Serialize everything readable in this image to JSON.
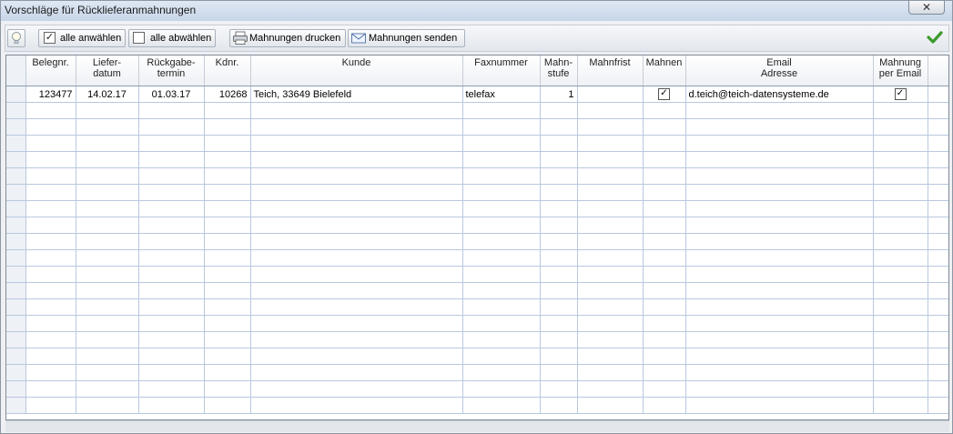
{
  "window": {
    "title": "Vorschläge für Rücklieferanmahnungen",
    "close_glyph": "✕"
  },
  "toolbar": {
    "select_all_label": "alle anwählen",
    "deselect_all_label": "alle abwählen",
    "print_label": "Mahnungen drucken",
    "send_label": "Mahnungen senden"
  },
  "grid": {
    "columns": [
      {
        "line1": "Belegnr.",
        "line2": ""
      },
      {
        "line1": "Liefer-",
        "line2": "datum"
      },
      {
        "line1": "Rückgabe-",
        "line2": "termin"
      },
      {
        "line1": "Kdnr.",
        "line2": ""
      },
      {
        "line1": "Kunde",
        "line2": ""
      },
      {
        "line1": "Faxnummer",
        "line2": ""
      },
      {
        "line1": "Mahn-",
        "line2": "stufe"
      },
      {
        "line1": "Mahnfrist",
        "line2": ""
      },
      {
        "line1": "Mahnen",
        "line2": ""
      },
      {
        "line1": "Email",
        "line2": "Adresse"
      },
      {
        "line1": "Mahnung",
        "line2": "per Email"
      }
    ],
    "rows": [
      {
        "belegnr": "123477",
        "lieferdatum": "14.02.17",
        "rueckgabetermin": "01.03.17",
        "kdnr": "10268",
        "kunde": "Teich, 33649 Bielefeld",
        "faxnummer": "telefax",
        "mahnstufe": "1",
        "mahnfrist": "",
        "mahnen": "✓",
        "email": "d.teich@teich-datensysteme.de",
        "per_email": "✓"
      }
    ]
  },
  "colors": {
    "accent_green": "#3a9a2a",
    "grid_line": "#b9c8df"
  }
}
